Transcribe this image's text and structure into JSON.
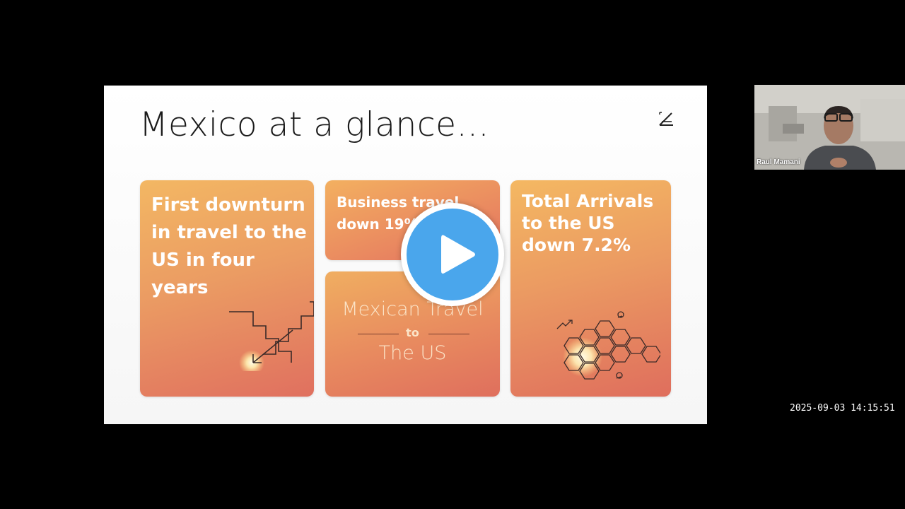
{
  "slide": {
    "title": "Mexico at a glance...",
    "cards": [
      {
        "text": "First downturn in travel to the US in four years"
      },
      {
        "text": "Business travel down 19%"
      },
      {
        "line1": "Mexican Travel",
        "line2": "to",
        "line3": "The US"
      },
      {
        "text": "Total Arrivals to the US down 7.2%"
      }
    ]
  },
  "video": {
    "play_icon": "play-icon"
  },
  "webcam": {
    "participant_name": "Raul Mamani"
  },
  "timestamp": "2025-09-03 14:15:51",
  "colors": {
    "card_warm": "#f3b763",
    "card_red": "#e0705f",
    "play": "#4aa6ec"
  }
}
